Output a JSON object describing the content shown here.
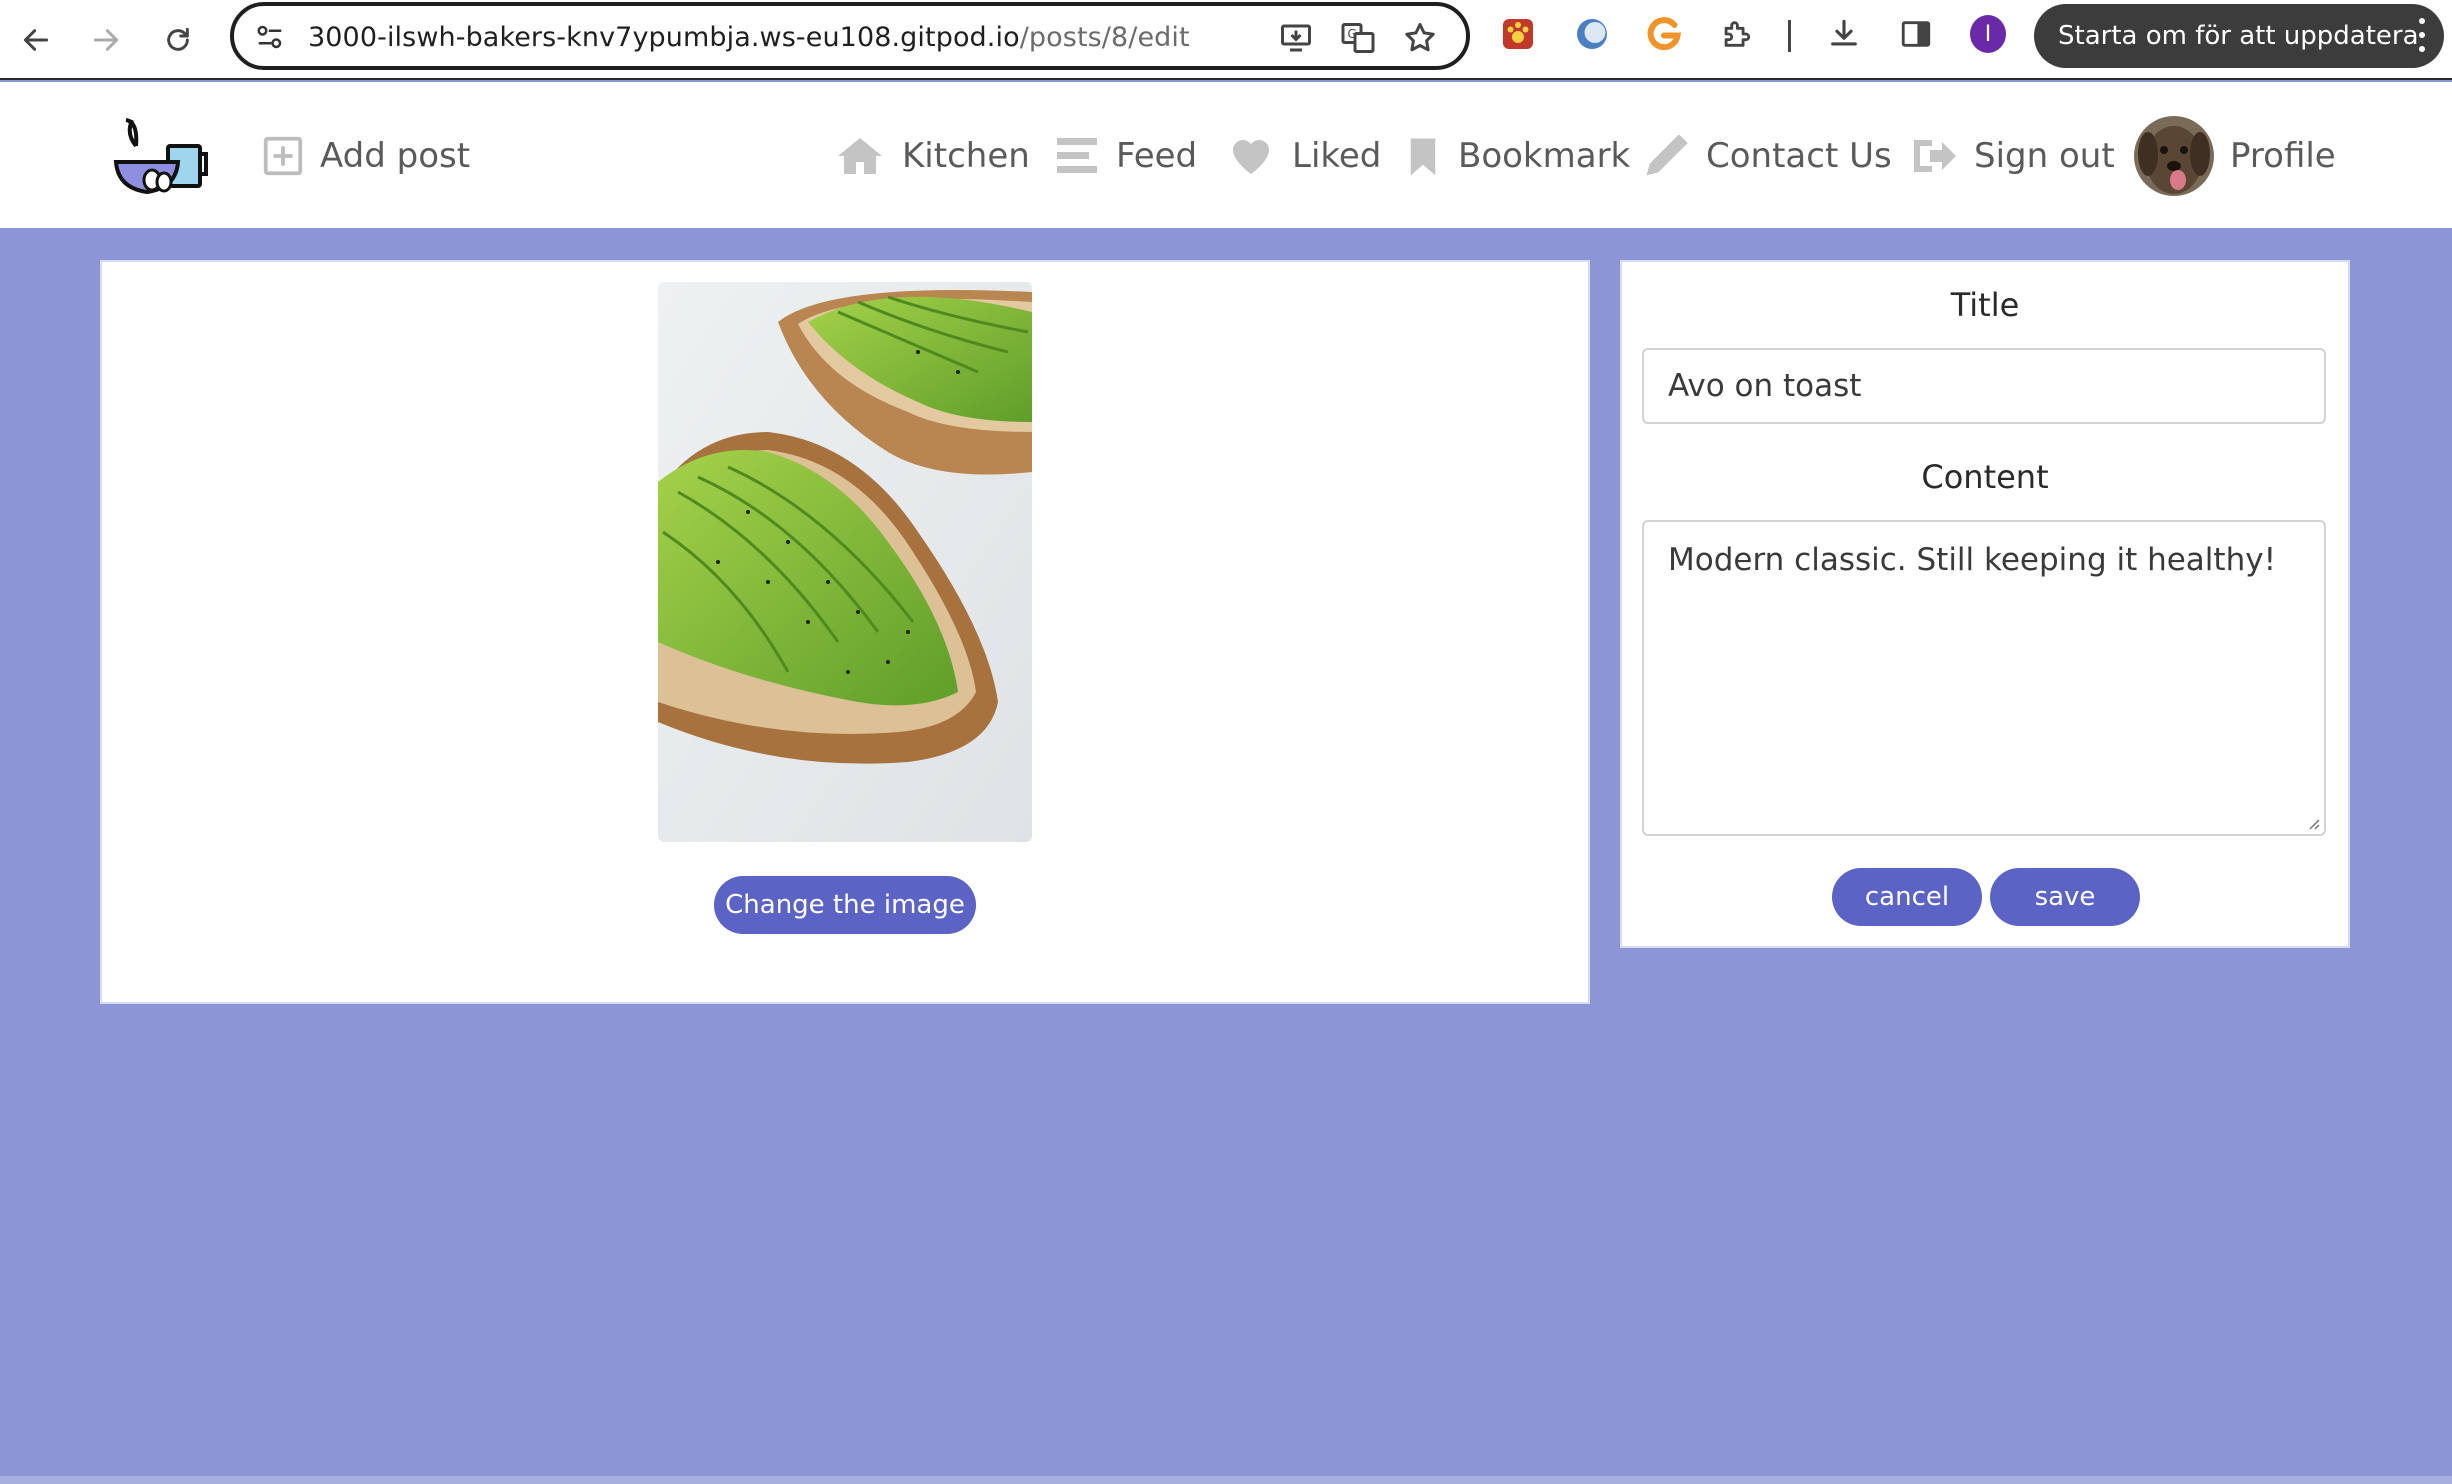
{
  "browser": {
    "url_host": "3000-ilswh-bakers-knv7ypumbja.ws-eu108.gitpod.io",
    "url_path": "/posts/8/edit",
    "profile_initial": "I",
    "update_label": "Starta om för att uppdatera",
    "icons": [
      "back-icon",
      "forward-icon",
      "reload-icon",
      "site-settings-icon",
      "install-app-icon",
      "translate-icon",
      "bookmark-star-icon",
      "extension-paw-icon",
      "extension-circle-icon",
      "extension-g-icon",
      "extensions-puzzle-icon",
      "downloads-icon",
      "side-panel-icon",
      "more-icon"
    ]
  },
  "header": {
    "add_post": "Add post",
    "nav": {
      "kitchen": "Kitchen",
      "feed": "Feed",
      "liked": "Liked",
      "bookmark": "Bookmark",
      "contact": "Contact Us",
      "signout": "Sign out",
      "profile": "Profile"
    }
  },
  "post": {
    "change_image_label": "Change the image"
  },
  "form": {
    "title_label": "Title",
    "title_value": "Avo on toast",
    "content_label": "Content",
    "content_value": "Modern classic. Still keeping it healthy!",
    "cancel_label": "cancel",
    "save_label": "save"
  },
  "colors": {
    "page_background": "#8c95d6",
    "button": "#5b63c5",
    "header_text": "#5a5a5a",
    "profile_badge": "#6a2aa8"
  }
}
